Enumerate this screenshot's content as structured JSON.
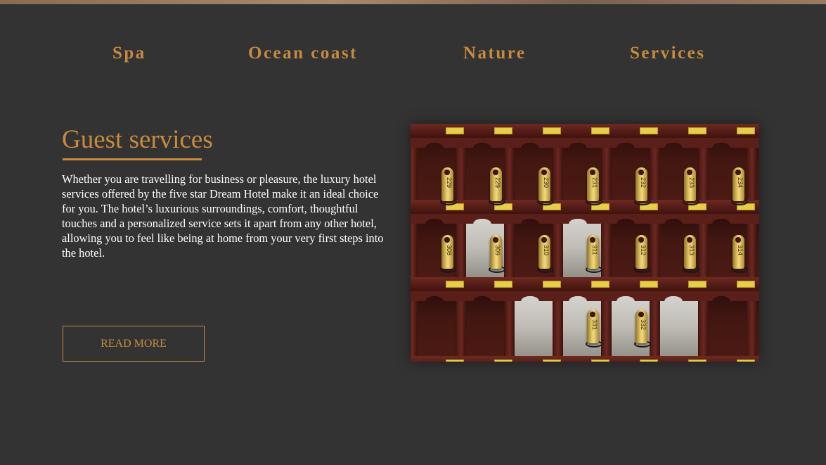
{
  "nav": {
    "items": [
      {
        "label": "Spa"
      },
      {
        "label": "Ocean coast"
      },
      {
        "label": "Nature"
      },
      {
        "label": "Services"
      }
    ]
  },
  "section": {
    "title": "Guest services",
    "body": "Whether you are travelling for business or pleasure, the luxury hotel services offered by the five star Dream Hotel make it an ideal choice for you. The hotel’s luxurious surroundings, comfort, thoughtful touches and a personalized service sets it apart from any other hotel, allowing you to feel like being at home from your very first steps into the hotel.",
    "button_label": "READ MORE"
  },
  "photo": {
    "key_numbers_row1": [
      "229",
      "229",
      "230",
      "231",
      "232",
      "233",
      "234"
    ],
    "key_numbers_row2": [
      "308",
      "309",
      "310",
      "311",
      "312",
      "313",
      "314"
    ],
    "key_numbers_row3": [
      "331",
      "332"
    ]
  },
  "colors": {
    "background": "#333333",
    "accent": "#c78b3e",
    "text": "#ffffff"
  }
}
